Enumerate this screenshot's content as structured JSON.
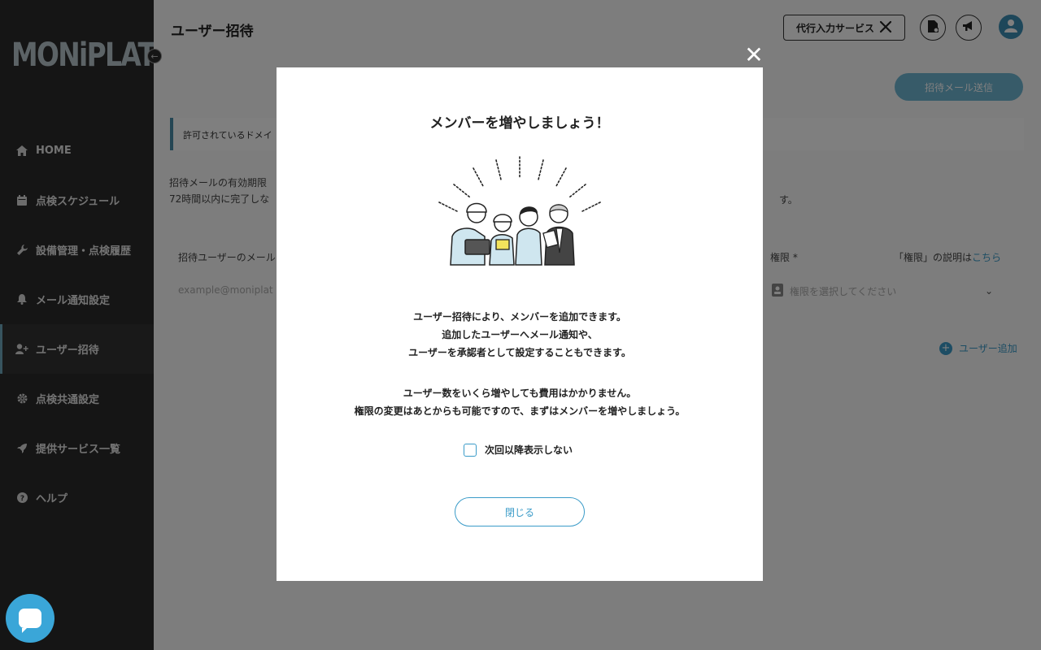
{
  "sidebar": {
    "logo": "MONiPLAT",
    "items": [
      {
        "label": "HOME",
        "icon": "home-icon"
      },
      {
        "label": "点検スケジュール",
        "icon": "calendar-icon"
      },
      {
        "label": "設備管理・点検履歴",
        "icon": "wrench-icon"
      },
      {
        "label": "メール通知設定",
        "icon": "bell-icon"
      },
      {
        "label": "ユーザー招待",
        "icon": "user-plus-icon",
        "active": true
      },
      {
        "label": "点検共通設定",
        "icon": "gear-icon"
      },
      {
        "label": "提供サービス一覧",
        "icon": "rocket-icon"
      },
      {
        "label": "ヘルプ",
        "icon": "help-icon"
      }
    ]
  },
  "header": {
    "title": "ユーザー招待",
    "proxy_button": "代行入力サービス"
  },
  "page": {
    "send_button": "招待メール送信",
    "notice": "許可されているドメイ",
    "desc_line1": "招待メールの有効期限",
    "desc_line2": "72時間以内に完了しな",
    "desc_tail": "す。",
    "email_header": "招待ユーザーのメール",
    "email_placeholder": "example@moniplat",
    "role_header": "権限",
    "role_required": "*",
    "role_help_prefix": "「権限」の説明は",
    "role_help_link": "こちら",
    "role_placeholder": "権限を選択してください",
    "add_user": "ユーザー追加"
  },
  "modal": {
    "close_symbol": "✕",
    "title": "メンバーを増やしましょう！",
    "text1": [
      "ユーザー招待により、メンバーを追加できます。",
      "追加したユーザーへメール通知や、",
      "ユーザーを承認者として設定することもできます。"
    ],
    "text2": [
      "ユーザー数をいくら増やしても費用はかかりません。",
      "権限の変更はあとからも可能ですので、まずはメンバーを増やしましょう。"
    ],
    "checkbox_label": "次回以降表示しない",
    "close_button": "閉じる"
  },
  "colors": {
    "accent": "#3a9bc8",
    "sidebar": "#2b2b2b",
    "overlay": "rgba(0,0,0,0.5)"
  }
}
